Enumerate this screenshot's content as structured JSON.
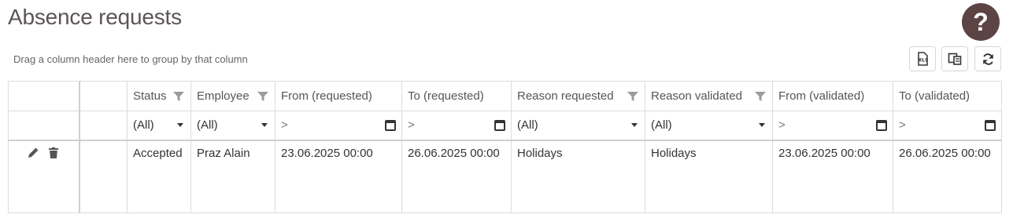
{
  "page": {
    "title": "Absence requests",
    "help_label": "?",
    "group_hint": "Drag a column header here to group by that column"
  },
  "toolbar": {
    "buttons": [
      {
        "name": "export-excel-icon"
      },
      {
        "name": "column-chooser-icon"
      },
      {
        "name": "refresh-icon"
      }
    ]
  },
  "grid": {
    "columns": [
      {
        "label": "",
        "filter": ""
      },
      {
        "label": "",
        "filter": ""
      },
      {
        "label": "Status",
        "filter": "(All)",
        "filter_type": "select",
        "filterable": true
      },
      {
        "label": "Employee",
        "filter": "(All)",
        "filter_type": "select",
        "filterable": true
      },
      {
        "label": "From (requested)",
        "filter": ">",
        "filter_type": "date"
      },
      {
        "label": "To (requested)",
        "filter": ">",
        "filter_type": "date"
      },
      {
        "label": "Reason requested",
        "filter": "(All)",
        "filter_type": "select",
        "filterable": true
      },
      {
        "label": "Reason validated",
        "filter": "(All)",
        "filter_type": "select",
        "filterable": true
      },
      {
        "label": "From (validated)",
        "filter": ">",
        "filter_type": "date"
      },
      {
        "label": "To (validated)",
        "filter": ">",
        "filter_type": "date"
      }
    ],
    "rows": [
      {
        "status": "Accepted",
        "employee": "Praz Alain",
        "from_requested": "23.06.2025 00:00",
        "to_requested": "26.06.2025 00:00",
        "reason_requested": "Holidays",
        "reason_validated": "Holidays",
        "from_validated": "23.06.2025 00:00",
        "to_validated": "26.06.2025 00:00"
      }
    ]
  },
  "colors": {
    "help_bg": "#5c4344",
    "title": "#5b5556",
    "border": "#dcdcdc",
    "icon": "#555555"
  }
}
